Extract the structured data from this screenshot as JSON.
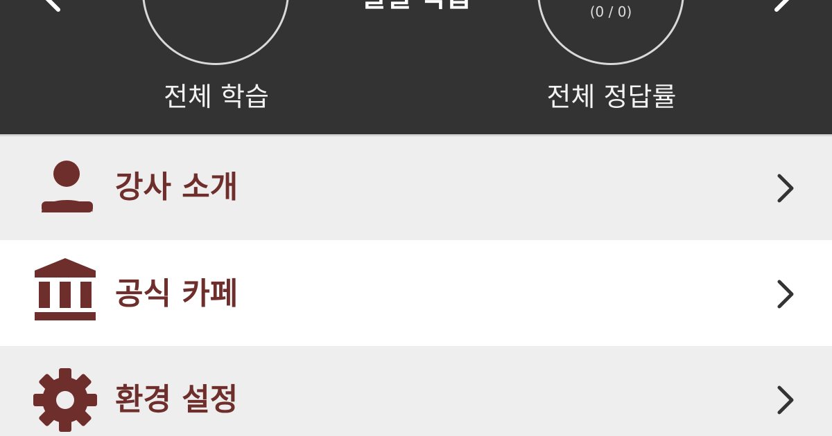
{
  "header": {
    "title": "일일 학습",
    "left_stat": {
      "value": "",
      "label": "전체 학습"
    },
    "right_stat": {
      "value": "(0 / 0)",
      "label": "전체 정답률"
    }
  },
  "menu": {
    "items": [
      {
        "label": "강사 소개",
        "icon": "person-icon"
      },
      {
        "label": "공식 카페",
        "icon": "bank-icon"
      },
      {
        "label": "환경 설정",
        "icon": "gear-icon"
      }
    ]
  },
  "colors": {
    "header_bg": "#333333",
    "accent": "#6e2f2c",
    "row_gray": "#eeeeee",
    "row_white": "#ffffff",
    "chevron": "#333333"
  }
}
